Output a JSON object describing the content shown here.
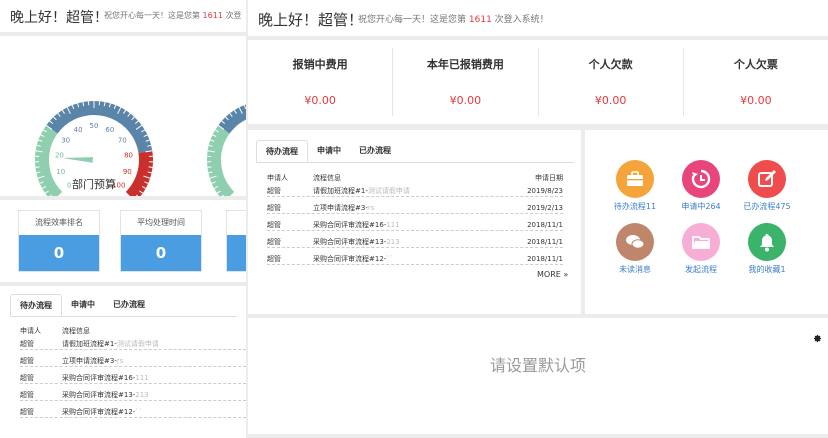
{
  "greeting": {
    "hello": "晚上好！超管！",
    "wish_prefix": "祝您开心每一天！这是您第",
    "login_count": "1611",
    "wish_suffix": "次登入系统！",
    "wish_suffix_short": "次登"
  },
  "gauge": {
    "label": "部门预算",
    "ticks": [
      "0",
      "10",
      "20",
      "30",
      "40",
      "50",
      "60",
      "70",
      "80",
      "90",
      "100"
    ],
    "value": 18,
    "colors": {
      "green": "#8fcfb0",
      "blue": "#5a84a8",
      "red": "#c9302c",
      "needle": "#8fcfb0"
    }
  },
  "efficiency": {
    "boxes": [
      {
        "title": "流程效率排名",
        "value": "0"
      },
      {
        "title": "平均处理时间",
        "value": "0"
      }
    ],
    "color": "#4a9de0"
  },
  "stats": [
    {
      "title": "报销中费用",
      "value": "¥0.00"
    },
    {
      "title": "本年已报销费用",
      "value": "¥0.00"
    },
    {
      "title": "个人欠款",
      "value": "¥0.00"
    },
    {
      "title": "个人欠票",
      "value": "¥0.00"
    }
  ],
  "tasks": {
    "tabs": [
      "待办流程",
      "申请中",
      "已办流程"
    ],
    "columns": {
      "applicant": "申请人",
      "info": "流程信息",
      "date": "申请日期"
    },
    "rows": [
      {
        "applicant": "超管",
        "info": "请假加班流程#1-",
        "sub": "测试请假申请",
        "date": "2019/8/23"
      },
      {
        "applicant": "超管",
        "info": "立项申请流程#3-",
        "sub": "rs",
        "date": "2019/2/13"
      },
      {
        "applicant": "超管",
        "info": "采购合同评审流程#16-",
        "sub": "111",
        "date": "2018/11/1"
      },
      {
        "applicant": "超管",
        "info": "采购合同评审流程#13-",
        "sub": "213",
        "date": "2018/11/1"
      },
      {
        "applicant": "超管",
        "info": "采购合同评审流程#12-",
        "sub": "``",
        "date": "2018/11/1"
      }
    ],
    "more": "MORE »"
  },
  "shortcuts": [
    {
      "label": "待办流程",
      "count": "11",
      "color": "#f5a33b",
      "icon": "briefcase-icon"
    },
    {
      "label": "申请中",
      "count": "264",
      "color": "#e8457d",
      "icon": "history-icon"
    },
    {
      "label": "已办流程",
      "count": "475",
      "color": "#ef4d4d",
      "icon": "edit-icon"
    },
    {
      "label": "未读消息",
      "count": "",
      "color": "#c0866b",
      "icon": "chat-icon"
    },
    {
      "label": "发起流程",
      "count": "",
      "color": "#f6aed4",
      "icon": "folder-icon"
    },
    {
      "label": "我的收藏",
      "count": "1",
      "color": "#3bb36a",
      "icon": "bell-icon"
    }
  ],
  "default_panel": {
    "message": "请设置默认项"
  }
}
